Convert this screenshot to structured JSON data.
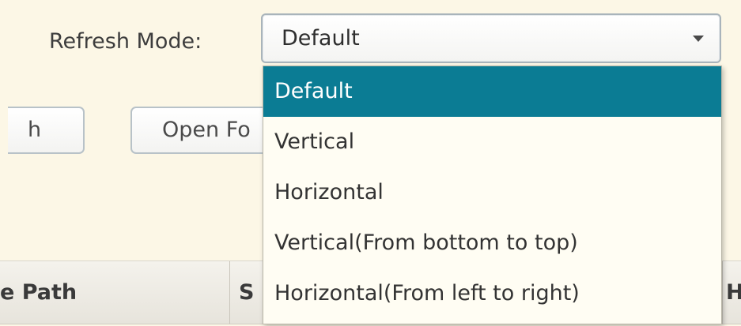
{
  "refresh_mode": {
    "label": "Refresh Mode:",
    "selected_value": "Default",
    "options": [
      {
        "label": "Default",
        "selected": true
      },
      {
        "label": "Vertical",
        "selected": false
      },
      {
        "label": "Horizontal",
        "selected": false
      },
      {
        "label": "Vertical(From bottom to top)",
        "selected": false
      },
      {
        "label": "Horizontal(From left to right)",
        "selected": false
      }
    ]
  },
  "toolbar": {
    "left_button_visible_text": "h",
    "open_button_visible_text": "Open Fo"
  },
  "table": {
    "headers": [
      {
        "visible_text": "e Path"
      },
      {
        "visible_text": "S"
      },
      {
        "visible_text": "He"
      }
    ]
  },
  "colors": {
    "background": "#fcf7e6",
    "selection": "#0b7c94",
    "selection_text": "#ffffff"
  },
  "icons": {
    "dropdown_arrow": "chevron-down-icon"
  }
}
